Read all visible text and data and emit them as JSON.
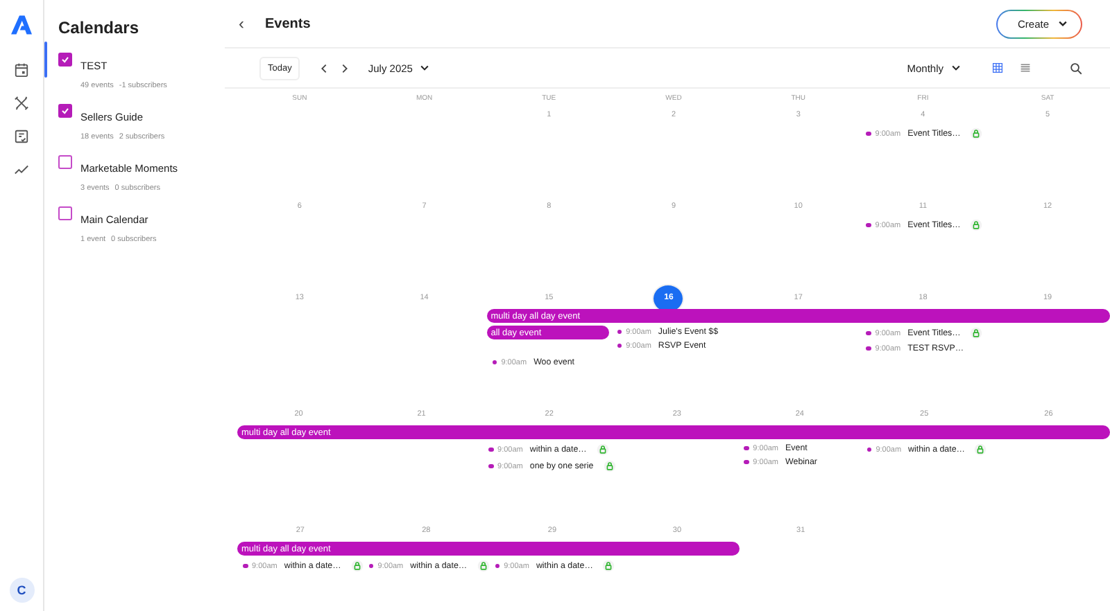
{
  "rail": {
    "items": [
      {
        "kind": "calendar",
        "selected": true
      },
      {
        "kind": "tools",
        "selected": false
      },
      {
        "kind": "checklist",
        "selected": false
      },
      {
        "kind": "chart",
        "selected": false
      }
    ],
    "avatar": "C"
  },
  "sidebar": {
    "title": "Calendars",
    "calendars": [
      {
        "name": "TEST",
        "checked": true,
        "events": "49 events",
        "subscribers": "-1 subscribers"
      },
      {
        "name": "Sellers Guide",
        "checked": true,
        "events": "18 events",
        "subscribers": "2 subscribers"
      },
      {
        "name": "Marketable Moments",
        "checked": false,
        "events": "3 events",
        "subscribers": "0 subscribers"
      },
      {
        "name": "Main Calendar",
        "checked": false,
        "events": "1 event",
        "subscribers": "0 subscribers"
      }
    ]
  },
  "header": {
    "back": "‹",
    "title": "Events",
    "create_button": "Create"
  },
  "toolbar": {
    "today_button": "Today",
    "month": "July 2025",
    "view": "Monthly",
    "views": [
      {
        "kind": "grid",
        "selected": true
      },
      {
        "kind": "list",
        "selected": false
      }
    ]
  },
  "calendar": {
    "weekdays": [
      "SUN",
      "MON",
      "TUE",
      "WED",
      "THU",
      "FRI",
      "SAT"
    ],
    "weeks": [
      {
        "days": [
          {
            "number": "1",
            "today": false
          },
          {
            "number": "2",
            "today": false
          },
          {
            "number": "3",
            "today": false
          },
          {
            "number": "4",
            "today": false,
            "events": [
              {
                "time": "9:00am",
                "title": "Event Titles…",
                "badge": true
              }
            ]
          },
          {
            "number": "5",
            "today": false
          }
        ]
      },
      {
        "days": [
          {
            "number": "6",
            "today": false
          },
          {
            "number": "7",
            "today": false
          },
          {
            "number": "8",
            "today": false
          },
          {
            "number": "9",
            "today": false
          },
          {
            "number": "10",
            "today": false
          },
          {
            "number": "11",
            "today": false,
            "events": [
              {
                "time": "9:00am",
                "title": "Event Titles…",
                "badge": true
              }
            ]
          },
          {
            "number": "12",
            "today": false
          }
        ]
      },
      {
        "days": [
          {
            "number": "13",
            "today": false
          },
          {
            "number": "14",
            "today": false
          },
          {
            "number": "15",
            "today": false,
            "all_day": [
              {
                "kind": "start",
                "title": "multi day all day event"
              },
              {
                "kind": "start",
                "title": "all day event"
              }
            ],
            "events": [
              {
                "time": "9:00am",
                "title": "Woo event",
                "badge": false
              }
            ]
          },
          {
            "number": "16",
            "today": true,
            "all_day": [
              {
                "kind": "continue"
              }
            ],
            "events": [
              {
                "time": "9:00am",
                "title": "Julie's Event $$",
                "badge": false
              },
              {
                "time": "9:00am",
                "title": "RSVP Event",
                "badge": false
              }
            ]
          },
          {
            "number": "17",
            "today": false,
            "all_day": [
              {
                "kind": "continue"
              }
            ]
          },
          {
            "number": "18",
            "today": false,
            "all_day": [
              {
                "kind": "continue"
              }
            ],
            "events": [
              {
                "time": "9:00am",
                "title": "Event Titles…",
                "badge": true
              },
              {
                "time": "9:00am",
                "title": "TEST RSVP…",
                "badge": false
              }
            ]
          },
          {
            "number": "19",
            "today": false,
            "all_day": [
              {
                "kind": "continue"
              }
            ]
          }
        ]
      },
      {
        "days": [
          {
            "number": "20",
            "today": false,
            "all_day": [
              {
                "kind": "start",
                "title": "multi day all day event"
              }
            ]
          },
          {
            "number": "21",
            "today": false,
            "all_day": [
              {
                "kind": "continue"
              }
            ]
          },
          {
            "number": "22",
            "today": false,
            "all_day": [
              {
                "kind": "continue"
              }
            ],
            "events": [
              {
                "time": "9:00am",
                "title": "within a date…",
                "badge": true
              },
              {
                "time": "9:00am",
                "title": "one by one serie",
                "badge": true
              }
            ]
          },
          {
            "number": "23",
            "today": false,
            "all_day": [
              {
                "kind": "continue"
              }
            ]
          },
          {
            "number": "24",
            "today": false,
            "all_day": [
              {
                "kind": "continue"
              }
            ],
            "events": [
              {
                "time": "9:00am",
                "title": "Event",
                "badge": false
              },
              {
                "time": "9:00am",
                "title": "Webinar",
                "badge": false
              }
            ]
          },
          {
            "number": "25",
            "today": false,
            "all_day": [
              {
                "kind": "continue"
              }
            ],
            "events": [
              {
                "time": "9:00am",
                "title": "within a date…",
                "badge": true
              }
            ]
          },
          {
            "number": "26",
            "today": false,
            "all_day": [
              {
                "kind": "continue"
              }
            ]
          }
        ]
      },
      {
        "days": [
          {
            "number": "27",
            "today": false,
            "all_day": [
              {
                "kind": "start",
                "title": "multi day all day event"
              }
            ],
            "events": [
              {
                "time": "9:00am",
                "title": "within a date…",
                "badge": true
              }
            ]
          },
          {
            "number": "28",
            "today": false,
            "all_day": [
              {
                "kind": "continue"
              }
            ],
            "events": [
              {
                "time": "9:00am",
                "title": "within a date…",
                "badge": true
              }
            ]
          },
          {
            "number": "29",
            "today": false,
            "all_day": [
              {
                "kind": "continue"
              }
            ],
            "events": [
              {
                "time": "9:00am",
                "title": "within a date…",
                "badge": true
              }
            ]
          },
          {
            "number": "30",
            "today": false,
            "all_day": [
              {
                "kind": "continue"
              }
            ]
          },
          {
            "number": "31",
            "today": false
          }
        ]
      }
    ]
  }
}
